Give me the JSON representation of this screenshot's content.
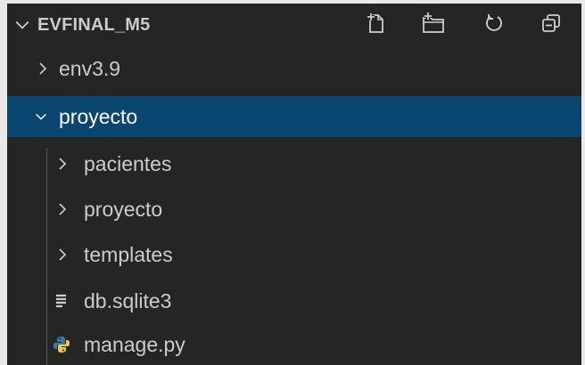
{
  "explorer": {
    "title": "EVFINAL_M5",
    "actions": [
      {
        "icon": "new-file-icon"
      },
      {
        "icon": "new-folder-icon"
      },
      {
        "icon": "refresh-icon"
      },
      {
        "icon": "collapse-all-icon"
      }
    ],
    "tree": [
      {
        "label": "env3.9",
        "type": "folder",
        "expanded": false
      },
      {
        "label": "proyecto",
        "type": "folder",
        "expanded": true,
        "selected": true
      },
      {
        "label": "pacientes",
        "type": "folder",
        "expanded": false
      },
      {
        "label": "proyecto",
        "type": "folder",
        "expanded": false
      },
      {
        "label": "templates",
        "type": "folder",
        "expanded": false
      },
      {
        "label": "db.sqlite3",
        "type": "file",
        "icon": "text-file-icon"
      },
      {
        "label": "manage.py",
        "type": "file",
        "icon": "python-file-icon"
      }
    ]
  },
  "colors": {
    "background": "#252526",
    "selection": "#094771",
    "text": "#cccccc",
    "python_blue": "#3b77a8",
    "python_yellow": "#f2c744"
  }
}
